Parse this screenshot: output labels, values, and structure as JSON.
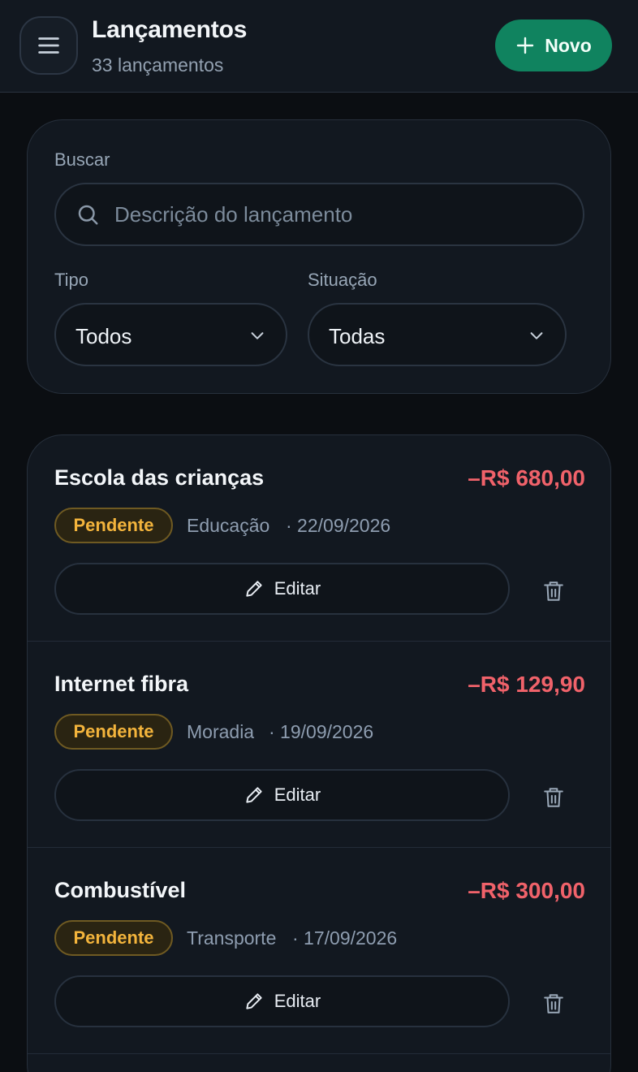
{
  "header": {
    "title": "Lançamentos",
    "subtitle": "33 lançamentos",
    "new_label": "Novo",
    "menu_icon": "menu-icon",
    "new_icon": "plus-icon"
  },
  "filters": {
    "search_label": "Buscar",
    "search_placeholder": "Descrição do lançamento",
    "search_value": "",
    "type_label": "Tipo",
    "type_value": "Todos",
    "status_label": "Situação",
    "status_value": "Todas"
  },
  "transactions": [
    {
      "name": "Escola das crianças",
      "amount": "–R$ 680,00",
      "status": "Pendente",
      "category": "Educação",
      "date": "· 22/09/2026",
      "edit_label": "Editar"
    },
    {
      "name": "Internet fibra",
      "amount": "–R$ 129,90",
      "status": "Pendente",
      "category": "Moradia",
      "date": "· 19/09/2026",
      "edit_label": "Editar"
    },
    {
      "name": "Combustível",
      "amount": "–R$ 300,00",
      "status": "Pendente",
      "category": "Transporte",
      "date": "· 17/09/2026",
      "edit_label": "Editar"
    }
  ],
  "colors": {
    "accent": "#10835f",
    "expense": "#f0626a",
    "pending": "#f3b43c",
    "background": "#0b0e12",
    "card": "#121820"
  }
}
